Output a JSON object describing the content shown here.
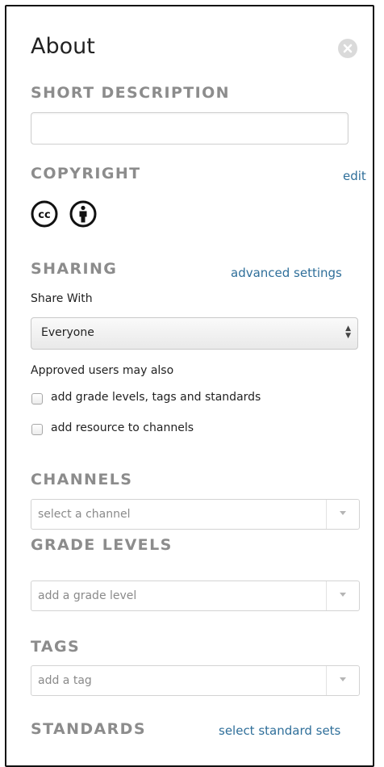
{
  "title": "About",
  "sections": {
    "short_description": {
      "label": "SHORT DESCRIPTION",
      "value": ""
    },
    "copyright": {
      "label": "COPYRIGHT",
      "edit_link": "edit",
      "icons": [
        "cc-icon",
        "attribution-icon"
      ]
    },
    "sharing": {
      "label": "SHARING",
      "advanced_link": "advanced settings",
      "share_with_label": "Share With",
      "share_with_value": "Everyone",
      "approved_label": "Approved users may also",
      "options": [
        {
          "label": "add grade levels, tags and standards",
          "checked": false
        },
        {
          "label": "add resource to channels",
          "checked": false
        }
      ]
    },
    "channels": {
      "label": "CHANNELS",
      "placeholder": "select a channel"
    },
    "grade_levels": {
      "label": "GRADE LEVELS",
      "placeholder": "add a grade level"
    },
    "tags": {
      "label": "TAGS",
      "placeholder": "add a tag"
    },
    "standards": {
      "label": "STANDARDS",
      "select_link": "select standard sets"
    }
  },
  "colors": {
    "link": "#2f6f9a",
    "section_label": "#8c8c8c",
    "panel_border": "#111111"
  }
}
